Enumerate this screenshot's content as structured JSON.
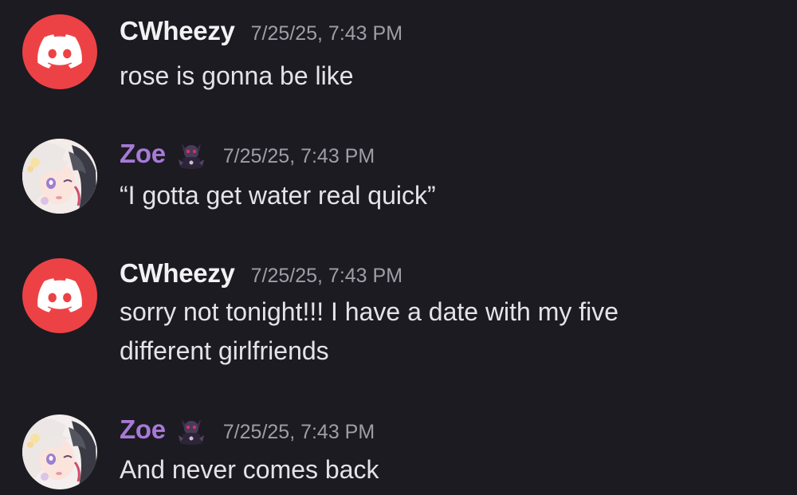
{
  "messages": [
    {
      "author": "CWheezy",
      "timestamp": "7/25/25, 7:43 PM",
      "avatar_icon": "discord-logo-icon",
      "avatar_color": "#ed4245",
      "lines": [
        "rose is gonna be like"
      ]
    },
    {
      "author": "Zoe",
      "timestamp": "7/25/25, 7:43 PM",
      "avatar_icon": "anime-girl-avatar",
      "badge_icon": "demon-chibi-badge-icon",
      "name_color": "#a77ad6",
      "lines": [
        "“I gotta get water real quick”"
      ]
    },
    {
      "author": "CWheezy",
      "timestamp": "7/25/25, 7:43 PM",
      "avatar_icon": "discord-logo-icon",
      "avatar_color": "#ed4245",
      "lines": [
        "sorry not tonight!!! I have a date with my five",
        "different girlfriends"
      ]
    },
    {
      "author": "Zoe",
      "timestamp": "7/25/25, 7:43 PM",
      "avatar_icon": "anime-girl-avatar",
      "badge_icon": "demon-chibi-badge-icon",
      "name_color": "#a77ad6",
      "lines": [
        "And never comes back"
      ]
    }
  ]
}
